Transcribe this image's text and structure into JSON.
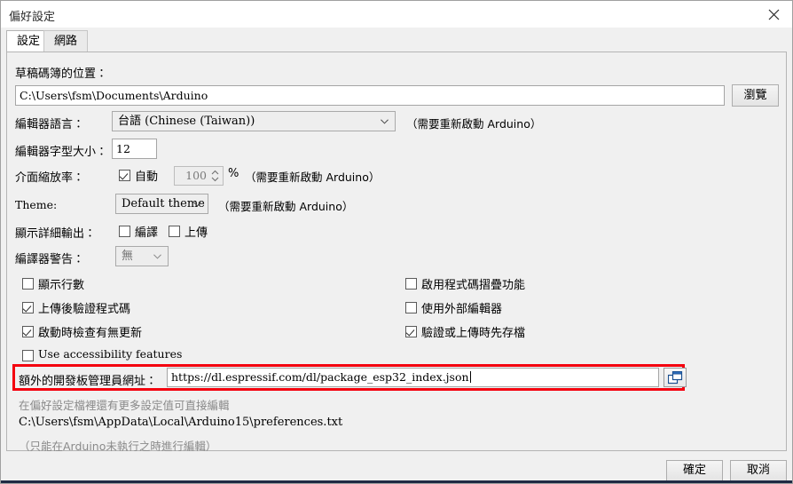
{
  "window": {
    "title": "偏好設定",
    "close_icon": "close-icon"
  },
  "tabs": [
    {
      "label": "設定",
      "active": true
    },
    {
      "label": "網路",
      "active": false
    }
  ],
  "sketchbook": {
    "label": "草稿碼簿的位置：",
    "value": "C:\\Users\\fsm\\Documents\\Arduino",
    "browse_label": "瀏覽"
  },
  "editor_language": {
    "label": "編輯器語言：",
    "value": "台語 (Chinese (Taiwan))",
    "note": "（需要重新啟動 Arduino）"
  },
  "editor_font_size": {
    "label": "編輯器字型大小：",
    "value": "12"
  },
  "interface_scale": {
    "label": "介面縮放率：",
    "auto_label": "自動",
    "auto_checked": true,
    "value": "100",
    "percent": "%",
    "note": "（需要重新啟動 Arduino）"
  },
  "theme": {
    "label": "Theme:",
    "value": "Default theme",
    "note": "（需要重新啟動 Arduino）"
  },
  "verbose_output": {
    "label": "顯示詳細輸出：",
    "compile_label": "編譯",
    "compile_checked": false,
    "upload_label": "上傳",
    "upload_checked": false
  },
  "compiler_warnings": {
    "label": "編譯器警告：",
    "value": "無"
  },
  "checkboxes_left": [
    {
      "label": "顯示行數",
      "checked": false,
      "latin": false
    },
    {
      "label": "上傳後驗證程式碼",
      "checked": true,
      "latin": false
    },
    {
      "label": "啟動時檢查有無更新",
      "checked": true,
      "latin": false
    },
    {
      "label": "Use accessibility features",
      "checked": false,
      "latin": true
    }
  ],
  "checkboxes_right": [
    {
      "label": "啟用程式碼摺疊功能",
      "checked": false
    },
    {
      "label": "使用外部編輯器",
      "checked": false
    },
    {
      "label": "驗證或上傳時先存檔",
      "checked": true
    }
  ],
  "board_manager_urls": {
    "label": "額外的開發板管理員網址：",
    "value": "https://dl.espressif.com/dl/package_esp32_index.json",
    "expand_icon": "open-editor-icon",
    "highlight_color": "#f4000e"
  },
  "footer": {
    "more_settings": "在偏好設定檔裡還有更多設定值可直接編輯",
    "prefs_path": "C:\\Users\\fsm\\AppData\\Local\\Arduino15\\preferences.txt",
    "edit_hint": "（只能在Arduino未執行之時進行編輯）"
  },
  "buttons": {
    "ok": "確定",
    "cancel": "取消"
  }
}
